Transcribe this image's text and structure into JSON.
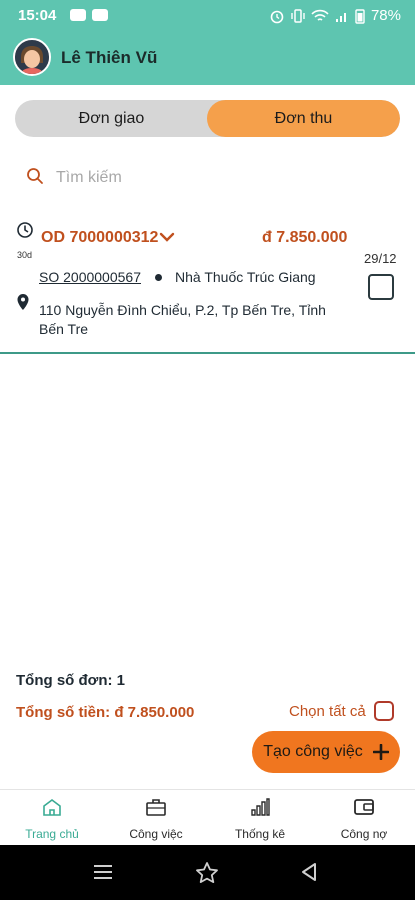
{
  "status": {
    "time": "15:04",
    "battery": "78%"
  },
  "header": {
    "user_name": "Lê Thiên Vũ"
  },
  "segments": {
    "delivery": "Đơn giao",
    "collection": "Đơn thu",
    "active": "collection"
  },
  "search": {
    "placeholder": "Tìm kiếm"
  },
  "order": {
    "id": "OD 7000000312",
    "amount": "đ 7.850.000",
    "age": "30d",
    "date": "29/12",
    "so_number": "SO 2000000567",
    "customer": "Nhà Thuốc Trúc Giang",
    "address": "110 Nguyễn Đình Chiểu, P.2, Tp Bến Tre, Tỉnh Bến Tre",
    "selected": false
  },
  "summary": {
    "total_orders": "Tổng số đơn: 1",
    "total_money": "Tổng số tiền: đ 7.850.000",
    "select_all": "Chọn tất cả"
  },
  "actions": {
    "create_task": "Tạo công việc"
  },
  "bottom_nav": {
    "items": [
      {
        "label": "Trang chủ",
        "icon": "home-icon",
        "active": true
      },
      {
        "label": "Công việc",
        "icon": "briefcase-icon",
        "active": false
      },
      {
        "label": "Thống kê",
        "icon": "chart-icon",
        "active": false
      },
      {
        "label": "Công nợ",
        "icon": "wallet-icon",
        "active": false
      }
    ]
  },
  "colors": {
    "header": "#5ec5b0",
    "accent": "#f5a04b",
    "primary_button": "#f0761f",
    "order_text": "#c0501e",
    "active_nav": "#3aab94"
  }
}
